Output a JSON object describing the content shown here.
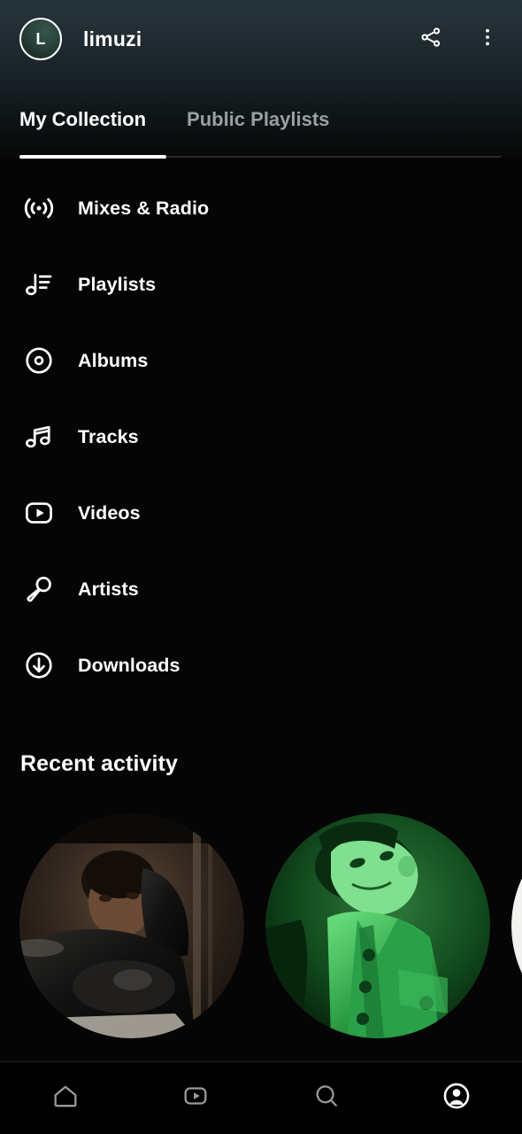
{
  "header": {
    "avatar_initial": "L",
    "avatar_name": "avatar",
    "user_name": "limuzi",
    "actions": [
      {
        "name": "share-icon",
        "label": "Share"
      },
      {
        "name": "overflow-menu-icon",
        "label": "More options"
      }
    ]
  },
  "tabs": [
    {
      "label": "My Collection",
      "active": true
    },
    {
      "label": "Public Playlists",
      "active": false
    }
  ],
  "nav_items": [
    {
      "label": "Mixes & Radio",
      "icon": "broadcast-icon"
    },
    {
      "label": "Playlists",
      "icon": "playlist-note-icon"
    },
    {
      "label": "Albums",
      "icon": "album-disc-icon"
    },
    {
      "label": "Tracks",
      "icon": "music-note-icon"
    },
    {
      "label": "Videos",
      "icon": "video-play-icon"
    },
    {
      "label": "Artists",
      "icon": "microphone-icon"
    },
    {
      "label": "Downloads",
      "icon": "download-arrow-icon"
    }
  ],
  "recent_activity": {
    "title": "Recent activity",
    "cards": [
      {
        "name": "recent-activity-card-1",
        "tone": "sepia"
      },
      {
        "name": "recent-activity-card-2",
        "tone": "green"
      },
      {
        "name": "recent-activity-card-3",
        "tone": "white"
      }
    ]
  },
  "bottom_nav": [
    {
      "name": "bottom-nav-home",
      "icon": "home-icon",
      "label": "Home",
      "active": false
    },
    {
      "name": "bottom-nav-videos",
      "icon": "video-play-icon",
      "label": "Videos",
      "active": false
    },
    {
      "name": "bottom-nav-search",
      "icon": "search-icon",
      "label": "Search",
      "active": false
    },
    {
      "name": "bottom-nav-profile",
      "icon": "profile-icon",
      "label": "Profile",
      "active": true
    }
  ],
  "colors": {
    "background": "#050505",
    "header_top": "#27343b",
    "text_primary": "#ffffff",
    "text_muted": "#9aa0a2",
    "nav_inactive": "#9a9a9a",
    "accent_green": "#2d9c54"
  }
}
